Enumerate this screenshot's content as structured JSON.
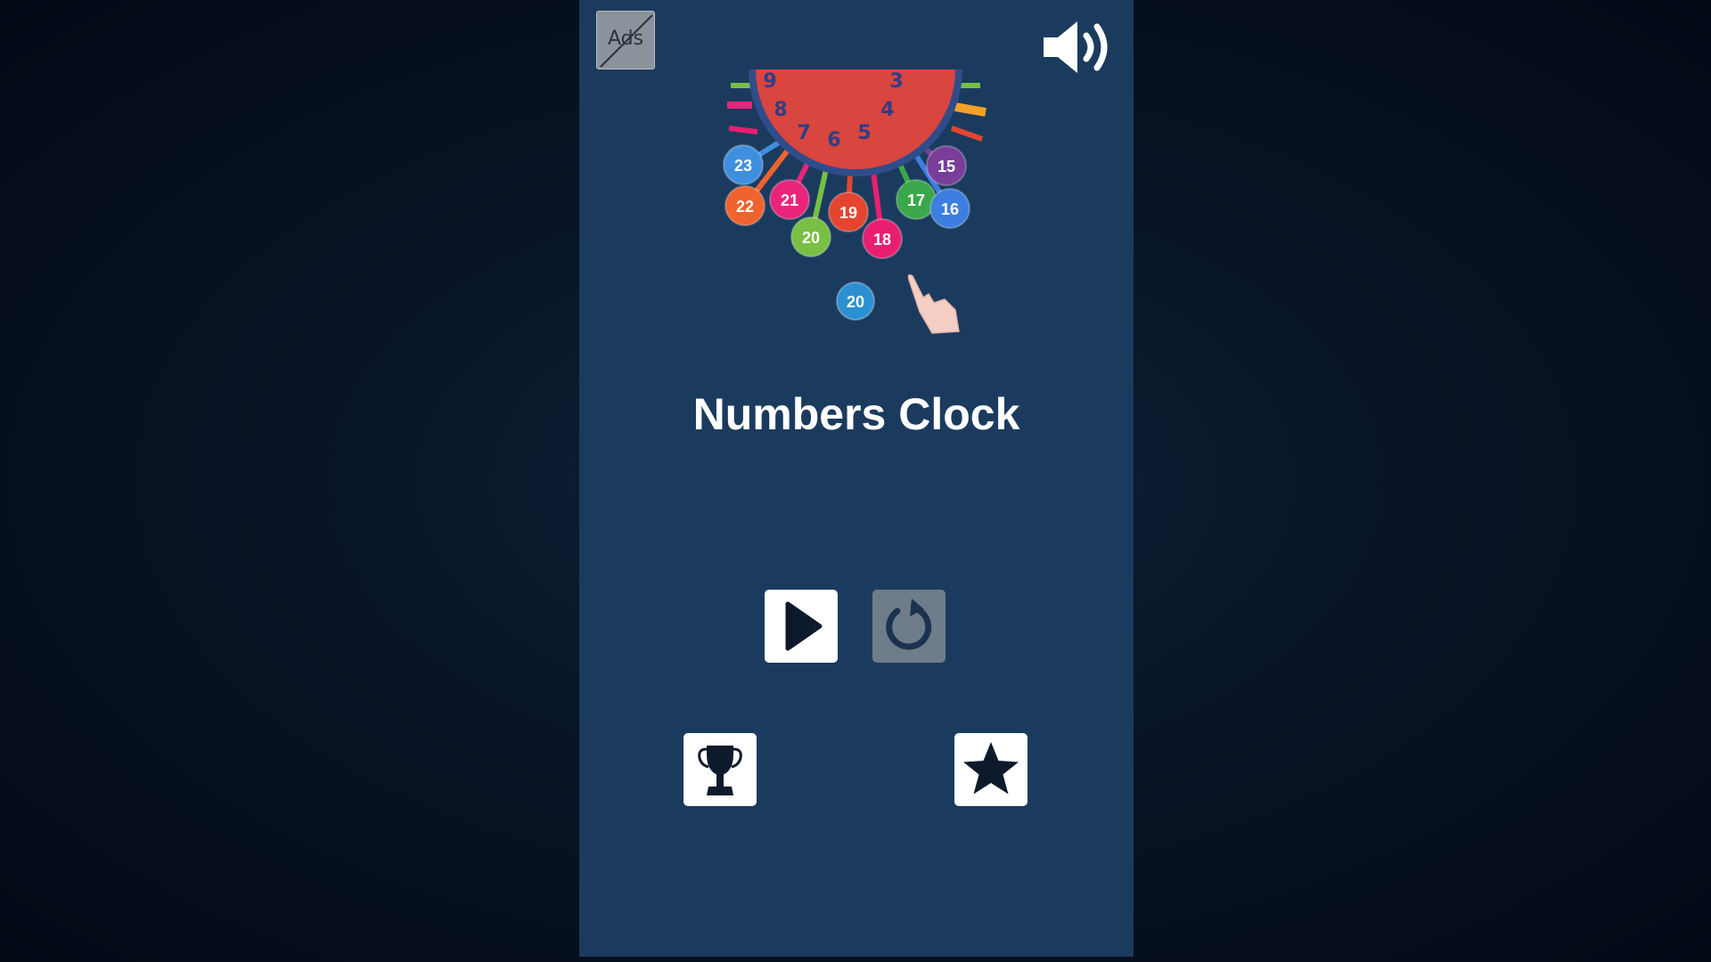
{
  "game": {
    "title": "Numbers Clock"
  },
  "topbar": {
    "ads_label": "Ads",
    "sound_icon": "speaker-icon"
  },
  "illustration": {
    "clock_numbers": [
      "9",
      "8",
      "7",
      "6",
      "5",
      "4",
      "3"
    ],
    "balls": [
      {
        "label": "23",
        "color": "#3f8fe0"
      },
      {
        "label": "22",
        "color": "#f0622e"
      },
      {
        "label": "21",
        "color": "#e8257a"
      },
      {
        "label": "20",
        "color": "#77c043"
      },
      {
        "label": "19",
        "color": "#e5452f"
      },
      {
        "label": "18",
        "color": "#e81f70"
      },
      {
        "label": "17",
        "color": "#3aa84a"
      },
      {
        "label": "16",
        "color": "#3d7fe0"
      },
      {
        "label": "15",
        "color": "#7a3d9a"
      }
    ],
    "next_ball": {
      "label": "20",
      "color": "#2b8fd0"
    },
    "hand_icon": "pointing-hand-icon"
  },
  "controls": {
    "play_icon": "play-icon",
    "restart_icon": "restart-icon",
    "leaderboard_icon": "trophy-icon",
    "rate_icon": "star-icon"
  },
  "colors": {
    "panel_background": "#1b3b5e",
    "clock_face": "#d9453f",
    "clock_rim": "#2f4d8a"
  }
}
